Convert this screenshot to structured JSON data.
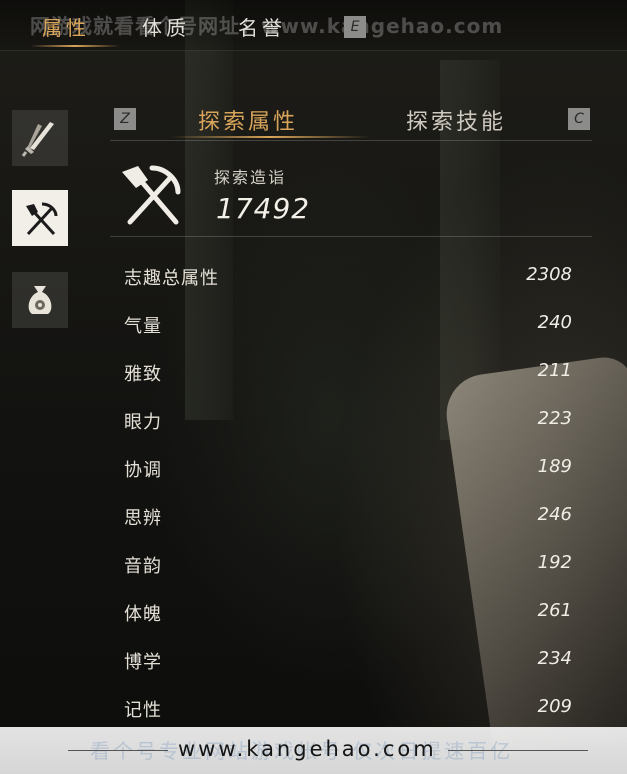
{
  "top_tabs": {
    "attributes": "属性",
    "constitution": "体质",
    "reputation": "名誉",
    "next_key": "E"
  },
  "watermark": {
    "top": "网游戏就看看个号网址：www.kangehao.com",
    "bottom_url": "www.kangehao.com",
    "bottom_faint": "看个号专业网站游戏帐号 仅次日提速百亿"
  },
  "side_nav": [
    {
      "icon": "sword-icon"
    },
    {
      "icon": "shovel-pickaxe-icon"
    },
    {
      "icon": "money-bag-icon"
    }
  ],
  "sub_tabs": {
    "prev_key": "Z",
    "explore_attributes": "探索属性",
    "explore_skills": "探索技能",
    "next_key": "C"
  },
  "explore": {
    "label": "探索造诣",
    "value": "17492"
  },
  "stats": [
    {
      "name": "志趣总属性",
      "value": "2308"
    },
    {
      "name": "气量",
      "value": "240"
    },
    {
      "name": "雅致",
      "value": "211"
    },
    {
      "name": "眼力",
      "value": "223"
    },
    {
      "name": "协调",
      "value": "189"
    },
    {
      "name": "思辨",
      "value": "246"
    },
    {
      "name": "音韵",
      "value": "192"
    },
    {
      "name": "体魄",
      "value": "261"
    },
    {
      "name": "博学",
      "value": "234"
    },
    {
      "name": "记性",
      "value": "209"
    }
  ],
  "colors": {
    "accent": "#d8a45a",
    "text": "#e8e4da",
    "background": "#15140f"
  }
}
